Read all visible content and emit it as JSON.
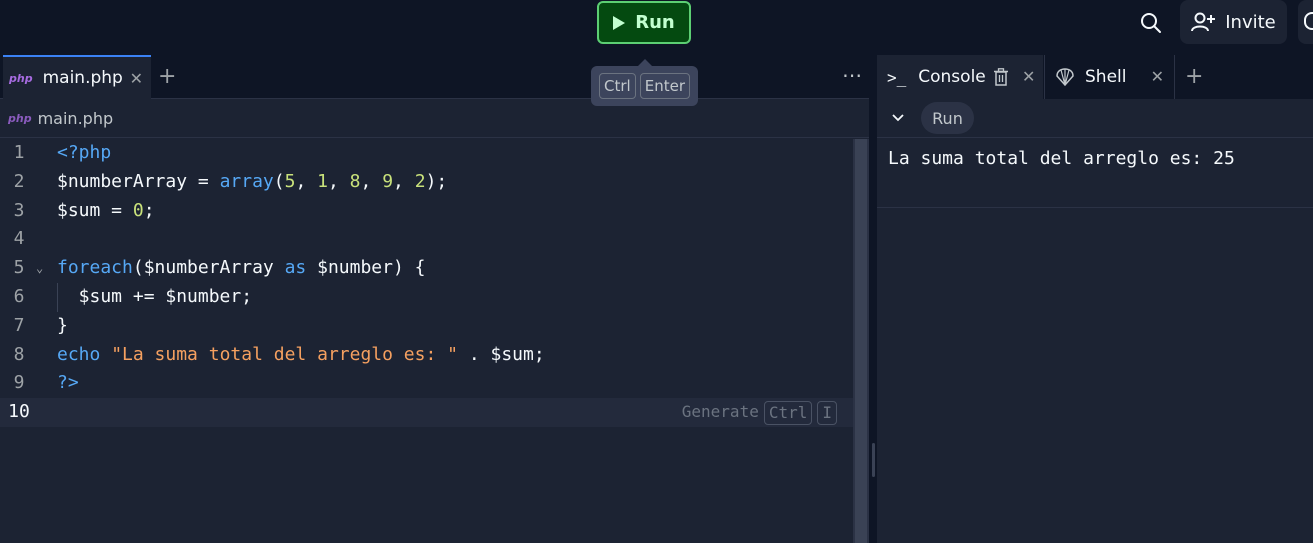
{
  "topbar": {
    "run_label": "Run",
    "invite_label": "Invite",
    "shortcut_keys": [
      "Ctrl",
      "Enter"
    ]
  },
  "editor": {
    "active_tab": "main.php",
    "breadcrumb": "main.php",
    "lang_badge": "php",
    "lines": [
      {
        "n": "1",
        "tokens": [
          {
            "t": "<?php",
            "c": "kw"
          }
        ]
      },
      {
        "n": "2",
        "tokens": [
          {
            "t": "$numberArray = "
          },
          {
            "t": "array",
            "c": "fn"
          },
          {
            "t": "("
          },
          {
            "t": "5",
            "c": "num"
          },
          {
            "t": ", "
          },
          {
            "t": "1",
            "c": "num"
          },
          {
            "t": ", "
          },
          {
            "t": "8",
            "c": "num"
          },
          {
            "t": ", "
          },
          {
            "t": "9",
            "c": "num"
          },
          {
            "t": ", "
          },
          {
            "t": "2",
            "c": "num"
          },
          {
            "t": ");"
          }
        ]
      },
      {
        "n": "3",
        "tokens": [
          {
            "t": "$sum = "
          },
          {
            "t": "0",
            "c": "num"
          },
          {
            "t": ";"
          }
        ]
      },
      {
        "n": "4",
        "tokens": []
      },
      {
        "n": "5",
        "fold": true,
        "tokens": [
          {
            "t": "foreach",
            "c": "kw"
          },
          {
            "t": "($numberArray "
          },
          {
            "t": "as",
            "c": "kw"
          },
          {
            "t": " $number) {"
          }
        ]
      },
      {
        "n": "6",
        "guide": true,
        "tokens": [
          {
            "t": "  $sum += $number;"
          }
        ]
      },
      {
        "n": "7",
        "tokens": [
          {
            "t": "}"
          }
        ]
      },
      {
        "n": "8",
        "tokens": [
          {
            "t": "echo",
            "c": "kw"
          },
          {
            "t": " "
          },
          {
            "t": "\"La suma total del arreglo es: \"",
            "c": "str"
          },
          {
            "t": " . $sum;"
          }
        ]
      },
      {
        "n": "9",
        "tokens": [
          {
            "t": "?>",
            "c": "kw"
          }
        ]
      },
      {
        "n": "10",
        "current": true,
        "tokens": []
      }
    ],
    "generate_hint": {
      "label": "Generate",
      "keys": [
        "Ctrl",
        "I"
      ]
    }
  },
  "console": {
    "tabs": [
      {
        "label": "Console"
      },
      {
        "label": "Shell"
      }
    ],
    "run_chip": "Run",
    "output": "La suma total del arreglo es: 25"
  }
}
